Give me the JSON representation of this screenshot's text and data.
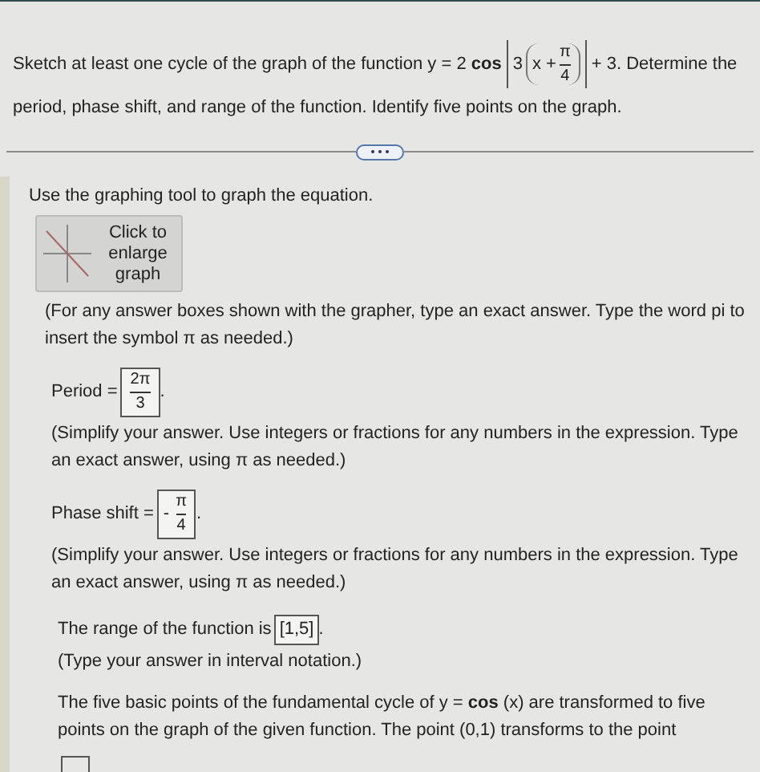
{
  "question": {
    "lead": "Sketch at least one cycle of the graph of the function y = 2",
    "fn": "cos",
    "coefficient": "3",
    "variable": "x +",
    "numerator": "π",
    "denominator": "4",
    "tail": "+ 3. Determine the",
    "line2": "period, phase shift, and range of the function. Identify five points on the graph."
  },
  "instruction": "Use the graphing tool to graph the equation.",
  "graph_button": {
    "label": "Click to enlarge graph"
  },
  "grapher_note": "(For any answer boxes shown with the grapher, type an exact answer. Type the word pi to insert the symbol π as needed.)",
  "answers": [
    {
      "label": "Period =",
      "numerator": "2π",
      "denominator": "3",
      "end": ".",
      "note": "(Simplify your answer. Use integers or fractions for any numbers in the expression. Type an exact answer, using π as needed.)"
    },
    {
      "label": "Phase shift =",
      "sign": "-",
      "numerator": "π",
      "denominator": "4",
      "end": ".",
      "note": "(Simplify your answer. Use integers or fractions for any numbers in the expression. Type an exact answer, using π as needed.)"
    }
  ],
  "range": {
    "label": "The range of the function is",
    "value": "[1,5]",
    "end": ".",
    "note": "(Type your answer in interval notation.)"
  },
  "points_text": "The five basic points of the fundamental cycle of y = **cos** (x) are transformed to five points on the graph of the given function. The point (0,1) transforms to the point"
}
